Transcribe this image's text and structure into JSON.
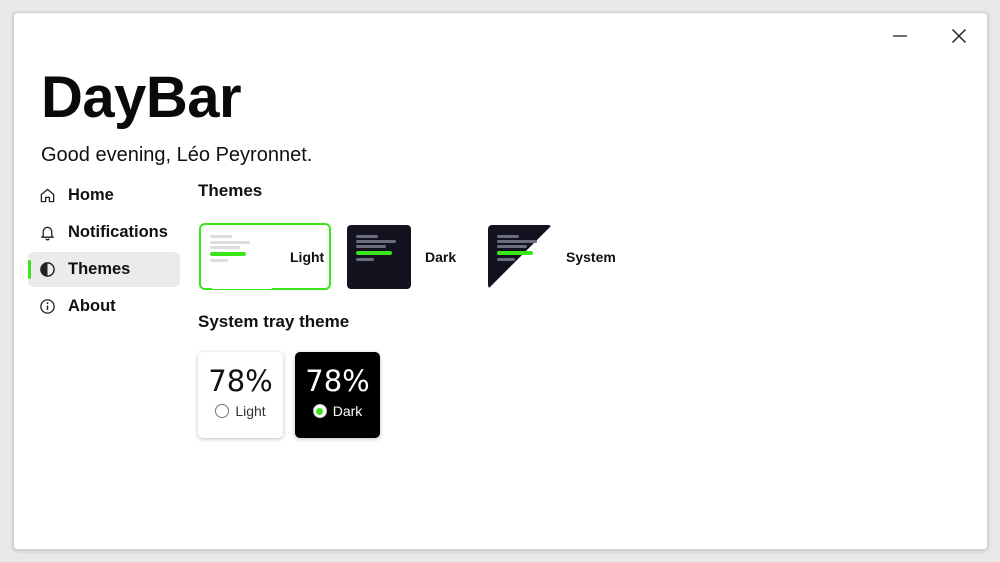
{
  "app": {
    "title": "DayBar",
    "greeting": "Good evening, Léo Peyronnet."
  },
  "window_controls": {
    "minimize_icon": "minimize-icon",
    "close_icon": "close-icon"
  },
  "sidebar": {
    "items": [
      {
        "label": "Home",
        "icon": "home-icon",
        "active": false
      },
      {
        "label": "Notifications",
        "icon": "bell-icon",
        "active": false
      },
      {
        "label": "Themes",
        "icon": "contrast-icon",
        "active": true
      },
      {
        "label": "About",
        "icon": "info-icon",
        "active": false
      }
    ]
  },
  "themes": {
    "title": "Themes",
    "options": [
      {
        "label": "Light",
        "selected": true
      },
      {
        "label": "Dark",
        "selected": false
      },
      {
        "label": "System",
        "selected": false
      }
    ]
  },
  "tray": {
    "title": "System tray theme",
    "options": [
      {
        "value": "78%",
        "label": "Light",
        "selected": false
      },
      {
        "value": "78%",
        "label": "Dark",
        "selected": true
      }
    ]
  },
  "colors": {
    "accent": "#39e619",
    "dark_bg": "#12131f",
    "light_bg": "#ffffff"
  }
}
